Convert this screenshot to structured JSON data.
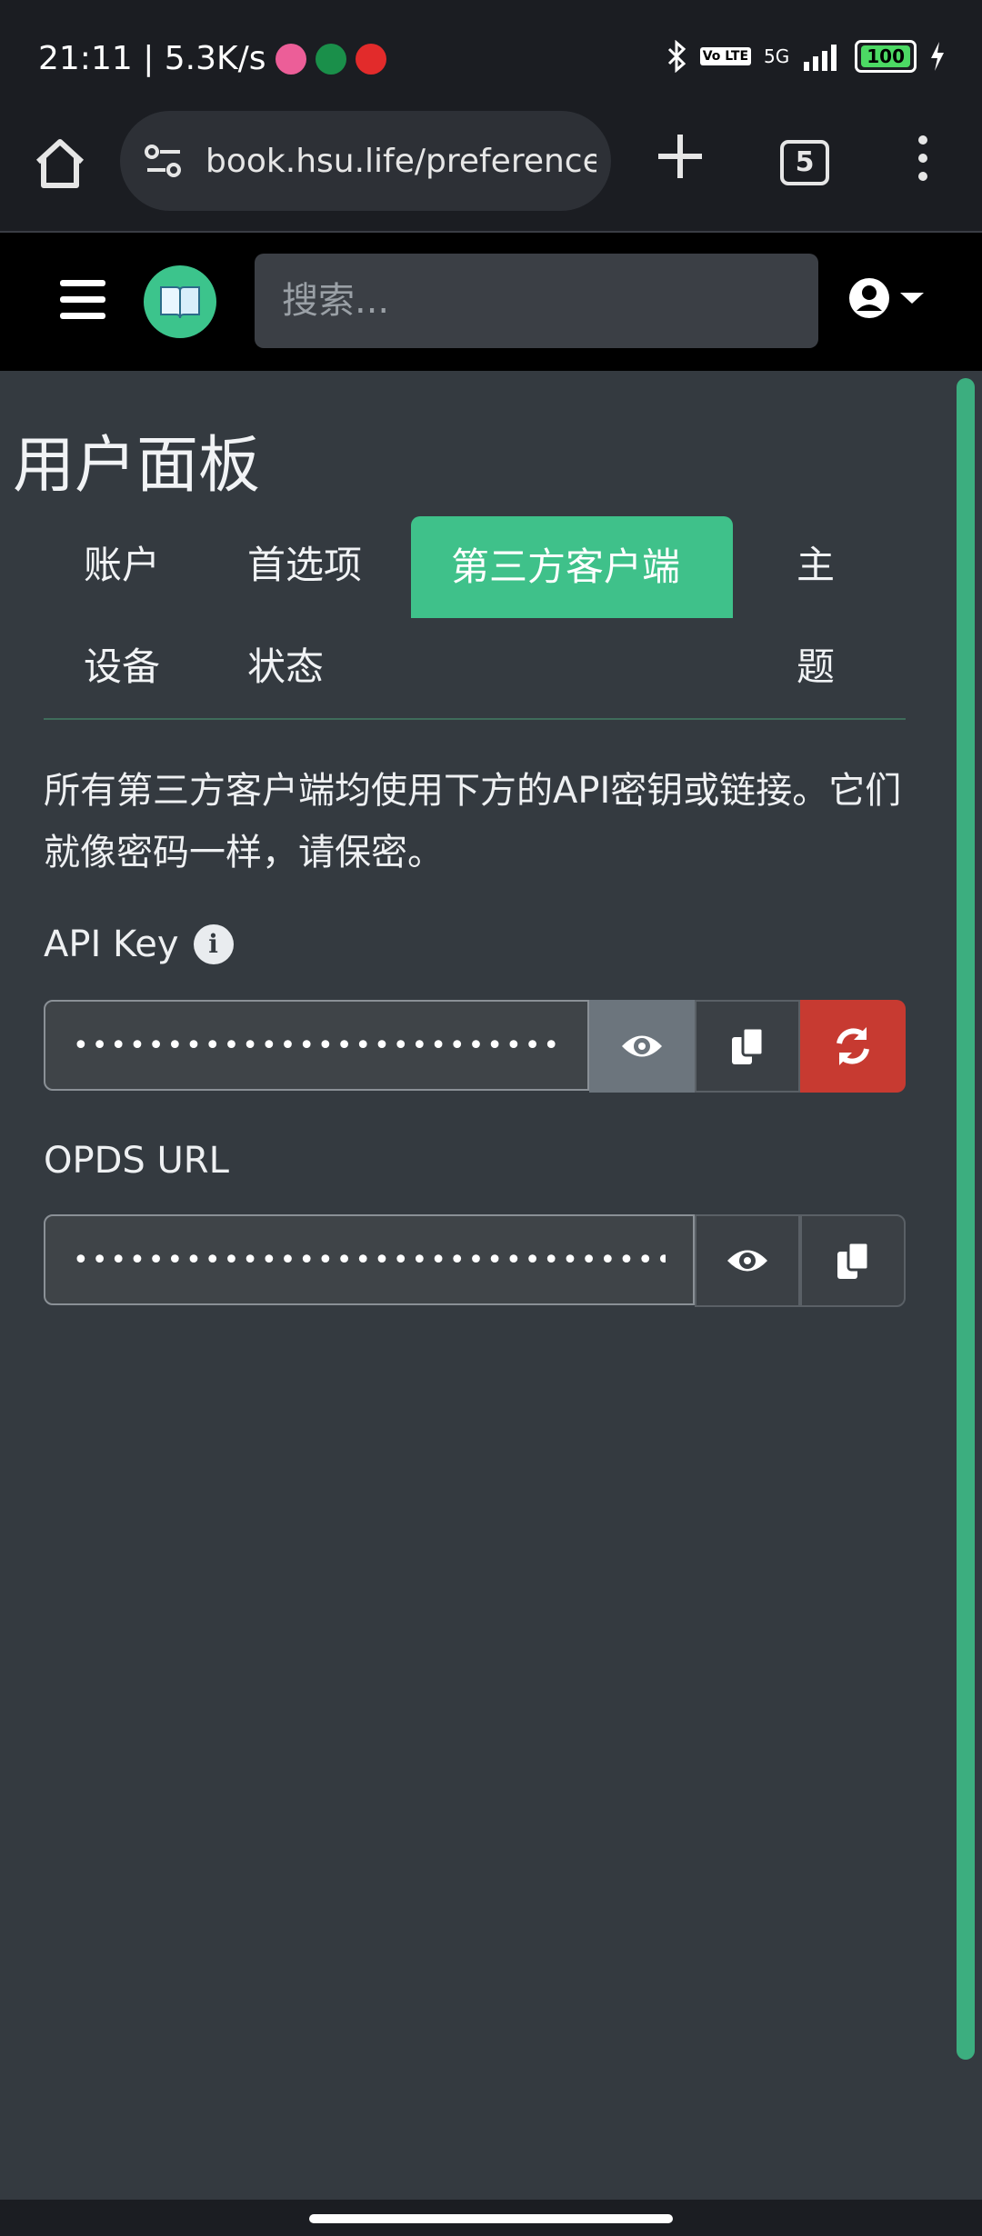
{
  "status_bar": {
    "time_speed": "21:11 | 5.3K/s",
    "network": "5G",
    "volte": "Vo LTE",
    "battery": "100"
  },
  "browser": {
    "url": "book.hsu.life/preferences#",
    "tab_count": "5"
  },
  "navbar": {
    "search_placeholder": "搜索..."
  },
  "page": {
    "title": "用户面板",
    "tabs": [
      "账户",
      "首选项",
      "第三方客户端",
      "主题",
      "设备",
      "状态"
    ],
    "active_tab": "第三方客户端",
    "description": "所有第三方客户端均使用下方的API密钥或链接。它们就像密码一样，请保密。",
    "api_key": {
      "label": "API Key",
      "value": "••••••••••••••••••••••••••••••••••••"
    },
    "opds_url": {
      "label": "OPDS URL",
      "value": "•••••••••••••••••••••••••••••••••••••••••••••"
    }
  },
  "colors": {
    "accent": "#3fc18a",
    "danger": "#c73a31",
    "background": "#343a40",
    "navbar": "#000000"
  }
}
